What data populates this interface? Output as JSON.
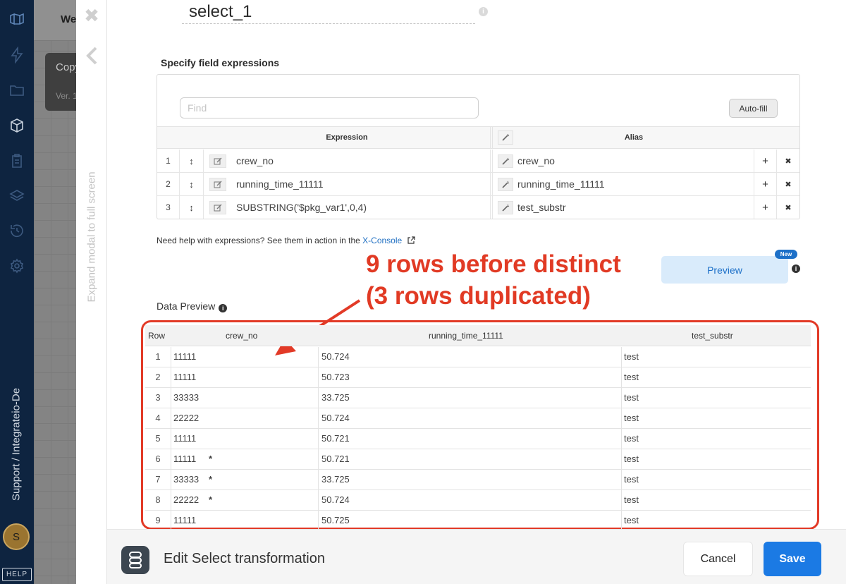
{
  "background": {
    "topbar_text": "We",
    "card_title": "Copy",
    "card_version": "Ver. 1"
  },
  "sidebar": {
    "icons": [
      "logo-icon",
      "bolt-icon",
      "folder-icon",
      "package-icon",
      "clipboard-icon",
      "layers-icon",
      "history-icon",
      "gear-icon"
    ],
    "support_text": "Support / Integrateio-De",
    "avatar_initial": "S",
    "help_label": "HELP"
  },
  "modal": {
    "close_glyph": "✖",
    "expand_label": "Expand modal to full screen",
    "name_value": "select_1",
    "name_info_glyph": "i",
    "section_title": "Specify field expressions",
    "find_placeholder": "Find",
    "autofill_label": "Auto-fill",
    "expr_header": "Expression",
    "alias_header": "Alias",
    "rows": [
      {
        "num": "1",
        "expression": "crew_no",
        "alias": "crew_no"
      },
      {
        "num": "2",
        "expression": "running_time_11111",
        "alias": "running_time_11111"
      },
      {
        "num": "3",
        "expression": "SUBSTRING('$pkg_var1',0,4)",
        "alias": "test_substr"
      }
    ],
    "add_glyph": "+",
    "delete_glyph": "✖",
    "drag_glyph": "↕",
    "help_text": "Need help with expressions? See them in action in the ",
    "help_link": "X-Console",
    "preview_label": "Preview",
    "new_badge": "New",
    "info_glyph": "i",
    "annotation_line1": "9 rows before distinct",
    "annotation_line2": "(3 rows duplicated)",
    "data_preview_title": "Data Preview",
    "accent_color": "#1d70c8",
    "annotation_color": "#e13a24"
  },
  "preview_table": {
    "columns": [
      "Row",
      "crew_no",
      "running_time_11111",
      "test_substr"
    ],
    "star_glyph": "*",
    "rows": [
      {
        "row": "1",
        "crew_no": "11111",
        "running_time": "50.724",
        "test_substr": "test",
        "duplicate": false
      },
      {
        "row": "2",
        "crew_no": "11111",
        "running_time": "50.723",
        "test_substr": "test",
        "duplicate": false
      },
      {
        "row": "3",
        "crew_no": "33333",
        "running_time": "33.725",
        "test_substr": "test",
        "duplicate": false
      },
      {
        "row": "4",
        "crew_no": "22222",
        "running_time": "50.724",
        "test_substr": "test",
        "duplicate": false
      },
      {
        "row": "5",
        "crew_no": "11111",
        "running_time": "50.721",
        "test_substr": "test",
        "duplicate": false
      },
      {
        "row": "6",
        "crew_no": "11111",
        "running_time": "50.721",
        "test_substr": "test",
        "duplicate": true
      },
      {
        "row": "7",
        "crew_no": "33333",
        "running_time": "33.725",
        "test_substr": "test",
        "duplicate": true
      },
      {
        "row": "8",
        "crew_no": "22222",
        "running_time": "50.724",
        "test_substr": "test",
        "duplicate": true
      },
      {
        "row": "9",
        "crew_no": "11111",
        "running_time": "50.725",
        "test_substr": "test",
        "duplicate": false
      }
    ]
  },
  "footer": {
    "icon": "select-transform-icon",
    "title": "Edit Select transformation",
    "cancel_label": "Cancel",
    "save_label": "Save",
    "save_color": "#1b7ae4"
  }
}
